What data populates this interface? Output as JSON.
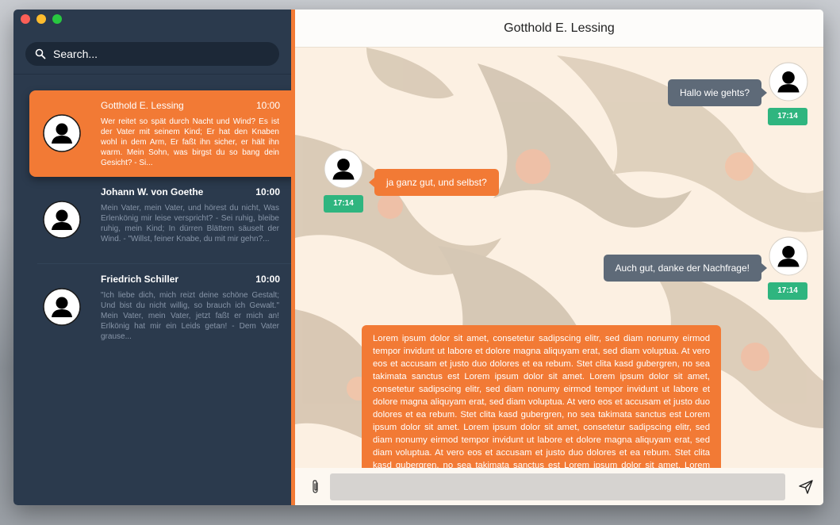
{
  "window": {
    "controls": [
      "close",
      "minimize",
      "zoom"
    ]
  },
  "sidebar": {
    "search": {
      "placeholder": "Search..."
    },
    "conversations": [
      {
        "name": "Gotthold E. Lessing",
        "time": "10:00",
        "preview": "Wer reitet so spät durch Nacht und Wind? Es ist der Vater mit seinem Kind; Er hat den Knaben wohl in dem Arm, Er faßt ihn sicher, er hält ihn warm. Mein Sohn, was birgst du so bang dein Gesicht? - Si...",
        "active": true
      },
      {
        "name": "Johann W. von Goethe",
        "time": "10:00",
        "preview": "Mein Vater, mein Vater, und hörest du nicht, Was Erlenkönig mir leise verspricht? - Sei ruhig, bleibe ruhig, mein Kind; In dürren Blättern säuselt der Wind. - \"Willst, feiner Knabe, du mit mir gehn?...",
        "active": false
      },
      {
        "name": "Friedrich Schiller",
        "time": "10:00",
        "preview": "\"Ich liebe dich, mich reizt deine schöne Gestalt; Und bist du nicht willig, so brauch ich Gewalt.\" Mein Vater, mein Vater, jetzt faßt er mich an! Erlkönig hat mir ein Leids getan! - Dem Vater grause...",
        "active": false
      }
    ]
  },
  "chat": {
    "title": "Gotthold E. Lessing",
    "messages": [
      {
        "side": "right",
        "text": "Hallo wie gehts?",
        "time": "17:14"
      },
      {
        "side": "left",
        "text": "ja ganz gut, und selbst?",
        "time": "17:14"
      },
      {
        "side": "right",
        "text": "Auch gut, danke der Nachfrage!",
        "time": "17:14"
      },
      {
        "side": "left",
        "text": "Lorem ipsum dolor sit amet, consetetur sadipscing elitr, sed diam nonumy eirmod tempor invidunt ut labore et dolore magna aliquyam erat, sed diam voluptua. At vero eos et accusam et justo duo dolores et ea rebum. Stet clita kasd gubergren, no sea takimata sanctus est Lorem ipsum dolor sit amet. Lorem ipsum dolor sit amet, consetetur sadipscing elitr, sed diam nonumy eirmod tempor invidunt ut labore et dolore magna aliquyam erat, sed diam voluptua. At vero eos et accusam et justo duo dolores et ea rebum. Stet clita kasd gubergren, no sea takimata sanctus est Lorem ipsum dolor sit amet. Lorem ipsum dolor sit amet, consetetur sadipscing elitr, sed diam nonumy eirmod tempor invidunt ut labore et dolore magna aliquyam erat, sed diam voluptua. At vero eos et accusam et justo duo dolores et ea rebum. Stet clita kasd gubergren, no sea takimata sanctus est Lorem ipsum dolor sit amet. Lorem ipsum dolor sit amet, consetetur sadipscing elitr, sed diam nonumy eirmod tempor invidunt ut labore et dolore magna aliquyam erat, sed diam voluptua."
      }
    ]
  },
  "composer": {
    "attach_icon": "paperclip-icon",
    "send_icon": "send-icon",
    "placeholder": ""
  },
  "colors": {
    "accent": "#f27a35",
    "sidebar": "#2b3a4d",
    "time_badge": "#2fb57f",
    "incoming_bubble": "#5e6a78"
  }
}
